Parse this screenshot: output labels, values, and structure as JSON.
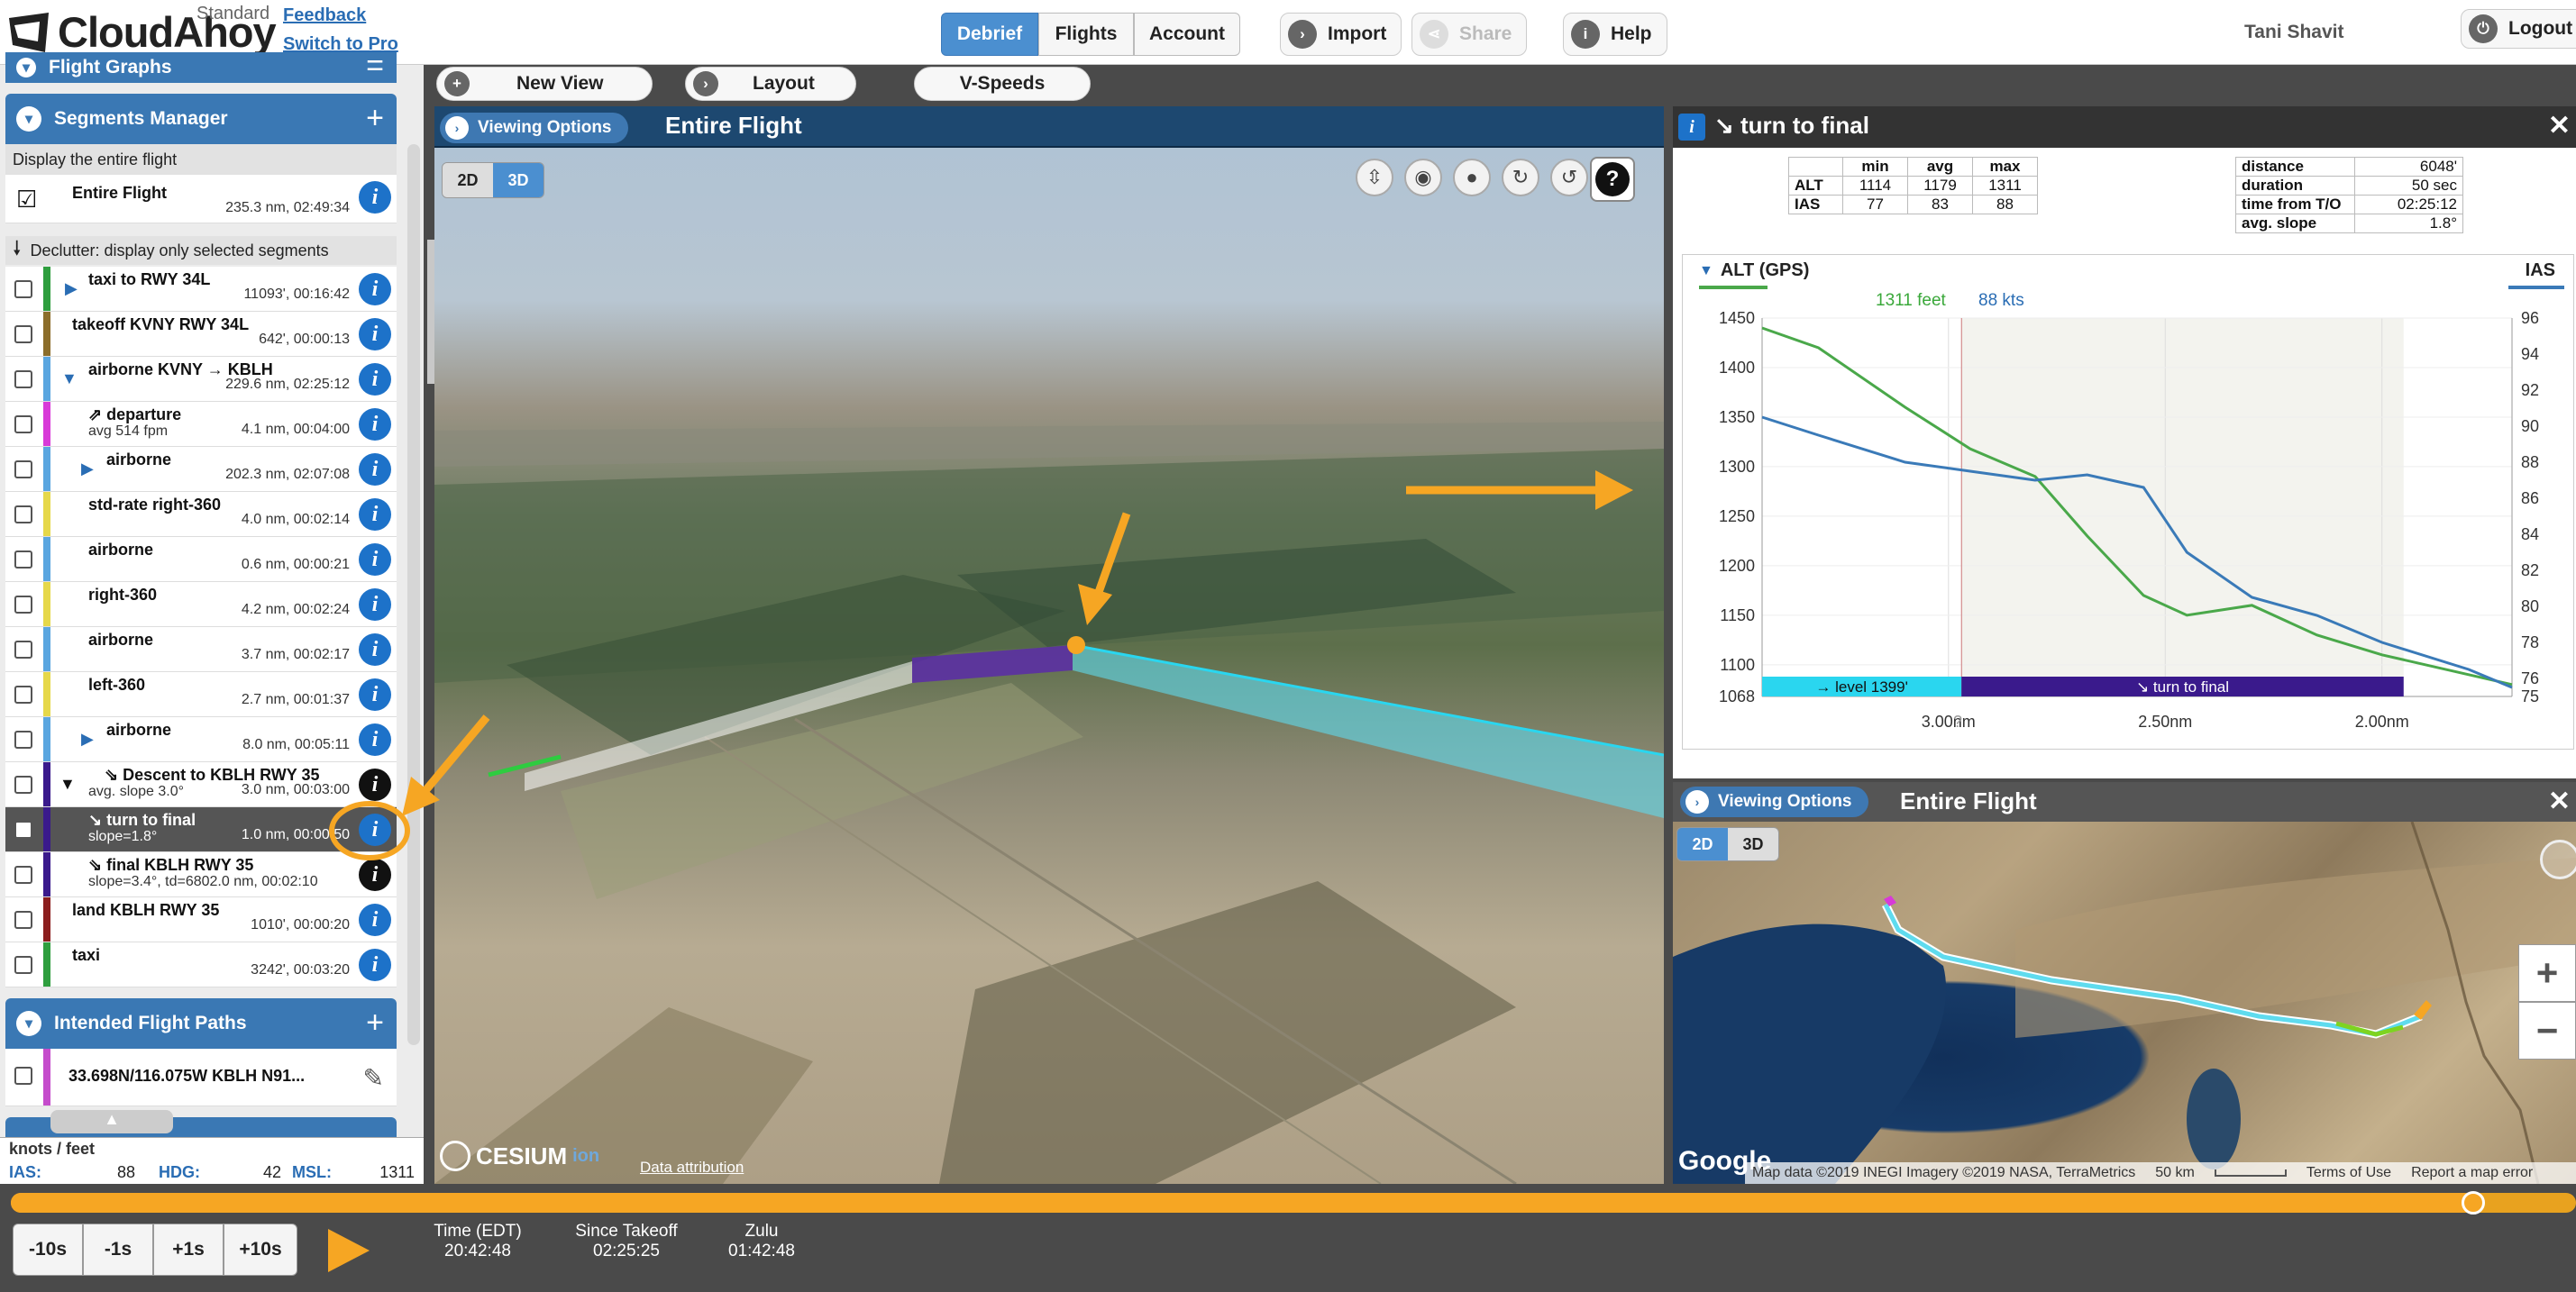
{
  "header": {
    "logo": "CloudAhoy",
    "plan": "Standard",
    "feedback": "Feedback",
    "switch_pro": "Switch to Pro",
    "tabs": [
      {
        "label": "Debrief",
        "active": true
      },
      {
        "label": "Flights"
      },
      {
        "label": "Account"
      }
    ],
    "import": "Import",
    "share": "Share",
    "help": "Help",
    "user": "Tani Shavit",
    "logout": "Logout"
  },
  "left": {
    "flight_graphs": "Flight Graphs",
    "segments_title": "Segments Manager",
    "display_entire": "Display the entire flight",
    "entire_name": "Entire Flight",
    "entire_val": "235.3 nm, 02:49:34",
    "declutter": "Declutter: display only selected segments",
    "segments": [
      {
        "name": "taxi to RWY 34L",
        "val": "11093', 00:16:42",
        "color": "#2e9e3e",
        "tri": "right",
        "indent": 0
      },
      {
        "name": "takeoff KVNY RWY 34L",
        "val": "642', 00:00:13",
        "color": "#8b6d2a",
        "indent": 0
      },
      {
        "name": "airborne KVNY → KBLH",
        "val": "229.6 nm, 02:25:12",
        "color": "#5aa6e0",
        "tri": "down",
        "indent": 0
      },
      {
        "name": "⇗ departure",
        "sub": "avg 514 fpm",
        "val": "4.1 nm, 00:04:00",
        "color": "#d83ad8",
        "indent": 1
      },
      {
        "name": "airborne",
        "val": "202.3 nm, 02:07:08",
        "color": "#5aa6e0",
        "tri": "right",
        "indent": 1
      },
      {
        "name": "std-rate right-360",
        "val": "4.0 nm, 00:02:14",
        "color": "#e6d84a",
        "indent": 1
      },
      {
        "name": "airborne",
        "val": "0.6 nm, 00:00:21",
        "color": "#5aa6e0",
        "indent": 1
      },
      {
        "name": "right-360",
        "val": "4.2 nm, 00:02:24",
        "color": "#e6d84a",
        "indent": 1
      },
      {
        "name": "airborne",
        "val": "3.7 nm, 00:02:17",
        "color": "#5aa6e0",
        "indent": 1
      },
      {
        "name": "left-360",
        "val": "2.7 nm, 00:01:37",
        "color": "#e6d84a",
        "indent": 1
      },
      {
        "name": "airborne",
        "val": "8.0 nm, 00:05:11",
        "color": "#5aa6e0",
        "tri": "right",
        "indent": 1
      },
      {
        "name": "⇘ Descent to KBLH RWY 35",
        "sub": "avg. slope 3.0°",
        "val": "3.0 nm, 00:03:00",
        "color": "#3a1a8c",
        "tri": "down-black",
        "info": "black",
        "indent": 1
      },
      {
        "name": "↘ turn to final",
        "sub": "slope=1.8°",
        "val": "1.0 nm, 00:00:50",
        "color": "#3a1a8c",
        "selected": true,
        "indent": 1
      },
      {
        "name": "⇘ final KBLH RWY 35",
        "sub": "slope=3.4°, td=6802.0 nm, 00:02:10",
        "val": "",
        "color": "#3a1a8c",
        "info": "black",
        "indent": 1
      },
      {
        "name": "land KBLH RWY 35",
        "val": "1010', 00:00:20",
        "color": "#8b1e1e",
        "indent": 0
      },
      {
        "name": "taxi",
        "val": "3242', 00:03:20",
        "color": "#2e9e3e",
        "indent": 0
      }
    ],
    "intended_title": "Intended Flight Paths",
    "intended_item": "33.698N/116.075W KBLH N91...",
    "readout_units": "knots / feet",
    "ias_label": "IAS:",
    "ias_val": "88",
    "hdg_label": "HDG:",
    "hdg_val": "42",
    "msl_label": "MSL:",
    "msl_val": "1311"
  },
  "toolbar": {
    "new_view": "New View",
    "layout": "Layout",
    "vspeeds": "V-Speeds"
  },
  "viewport": {
    "viewing_options": "Viewing Options",
    "title": "Entire Flight",
    "mode_2d": "2D",
    "mode_3d": "3D",
    "cesium": "CESIUM",
    "cesium_ion": "ion",
    "data_attr": "Data attribution",
    "help": "?"
  },
  "segment_panel": {
    "title": "↘ turn to final",
    "stats": {
      "header": [
        "",
        "min",
        "avg",
        "max"
      ],
      "rows": [
        [
          "ALT",
          "1114",
          "1179",
          "1311"
        ],
        [
          "IAS",
          "77",
          "83",
          "88"
        ]
      ]
    },
    "info": [
      [
        "distance",
        "6048'"
      ],
      [
        "duration",
        "50 sec"
      ],
      [
        "time from T/O",
        "02:25:12"
      ],
      [
        "avg. slope",
        "1.8°"
      ]
    ]
  },
  "chart_data": {
    "type": "line",
    "title": "",
    "left_label": "ALT (GPS)",
    "right_label": "IAS",
    "cursor_alt": "1311 feet",
    "cursor_ias": "88 kts",
    "x_ticks": [
      "3.00nm",
      "2.50nm",
      "2.00nm"
    ],
    "y_left_ticks": [
      1068,
      1100,
      1150,
      1200,
      1250,
      1300,
      1350,
      1400,
      1450
    ],
    "y_right_ticks": [
      75,
      76,
      78,
      80,
      82,
      84,
      86,
      88,
      90,
      92,
      94,
      96
    ],
    "ylim_left": [
      1068,
      1450
    ],
    "ylim_right": [
      75,
      96
    ],
    "series": [
      {
        "name": "ALT (GPS)",
        "color": "#4aa84a",
        "x": [
          3.43,
          3.3,
          3.1,
          2.95,
          2.8,
          2.68,
          2.55,
          2.45,
          2.3,
          2.15,
          2.0,
          1.8,
          1.7
        ],
        "values": [
          1440,
          1420,
          1360,
          1318,
          1290,
          1230,
          1170,
          1150,
          1160,
          1130,
          1110,
          1090,
          1080
        ]
      },
      {
        "name": "IAS",
        "color": "#3a7ab8",
        "x": [
          3.43,
          3.3,
          3.1,
          2.95,
          2.8,
          2.68,
          2.55,
          2.45,
          2.3,
          2.15,
          2.0,
          1.8,
          1.7
        ],
        "values": [
          90.5,
          89.5,
          88,
          87.5,
          87,
          87.3,
          86.6,
          83,
          80.5,
          79.5,
          78,
          76.5,
          75.5
        ]
      }
    ],
    "xlim": [
      3.43,
      1.7
    ],
    "segment_bands": [
      {
        "label": "→ level 1399'",
        "from": 3.43,
        "to": 2.97,
        "color": "#2ad6ef"
      },
      {
        "label": "↘ turn to final",
        "from": 2.97,
        "to": 1.95,
        "color": "#3a1a8c"
      }
    ]
  },
  "map": {
    "viewing_options": "Viewing Options",
    "title": "Entire Flight",
    "mode_2d": "2D",
    "mode_3d": "3D",
    "zoom_in": "+",
    "zoom_out": "−",
    "google": "Google",
    "attribution": "Map data ©2019 INEGI Imagery ©2019 NASA, TerraMetrics",
    "scale": "50 km",
    "terms": "Terms of Use",
    "report": "Report a map error"
  },
  "timeline": {
    "buttons": [
      "-10s",
      "-1s",
      "+1s",
      "+10s"
    ],
    "progress": 0.96,
    "time_edt_label": "Time (EDT)",
    "time_edt": "20:42:48",
    "since_label": "Since Takeoff",
    "since": "02:25:25",
    "zulu_label": "Zulu",
    "zulu": "01:42:48"
  },
  "colors": {
    "accent": "#3a78b4",
    "orange": "#f6a623",
    "header_dark": "#1d4870"
  }
}
